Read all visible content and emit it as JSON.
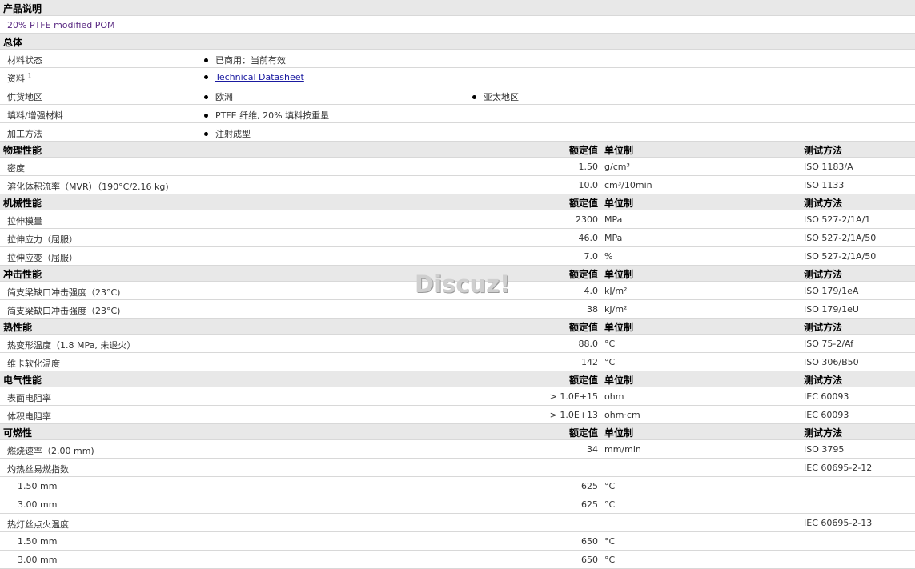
{
  "product": {
    "section_title": "产品说明",
    "description": "20% PTFE modified POM"
  },
  "general": {
    "section_title": "总体",
    "rows": [
      {
        "label": "材料状态",
        "values": [
          "已商用：当前有效"
        ]
      },
      {
        "label": "资料",
        "sup": "1",
        "link": "Technical Datasheet"
      },
      {
        "label": "供货地区",
        "values": [
          "欧洲",
          "亚太地区"
        ]
      },
      {
        "label": "填料/增强材料",
        "values": [
          "PTFE 纤维, 20% 填料按重量"
        ]
      },
      {
        "label": "加工方法",
        "values": [
          "注射成型"
        ]
      }
    ]
  },
  "col_headers": {
    "value": "额定值",
    "unit": "单位制",
    "method": "测试方法"
  },
  "sections": [
    {
      "title": "物理性能",
      "rows": [
        {
          "label": "密度",
          "value": "1.50",
          "unit": "g/cm³",
          "method": "ISO 1183/A"
        },
        {
          "label": "溶化体积流率（MVR）（190°C/2.16 kg)",
          "value": "10.0",
          "unit": "cm³/10min",
          "method": "ISO 1133"
        }
      ]
    },
    {
      "title": "机械性能",
      "rows": [
        {
          "label": "拉伸模量",
          "value": "2300",
          "unit": "MPa",
          "method": "ISO 527-2/1A/1"
        },
        {
          "label": "拉伸应力（屈服）",
          "value": "46.0",
          "unit": "MPa",
          "method": "ISO 527-2/1A/50"
        },
        {
          "label": "拉伸应变（屈服）",
          "value": "7.0",
          "unit": "%",
          "method": "ISO 527-2/1A/50"
        }
      ]
    },
    {
      "title": "冲击性能",
      "rows": [
        {
          "label": "简支梁缺口冲击强度（23°C)",
          "value": "4.0",
          "unit": "kJ/m²",
          "method": "ISO 179/1eA"
        },
        {
          "label": "简支梁缺口冲击强度（23°C)",
          "value": "38",
          "unit": "kJ/m²",
          "method": "ISO 179/1eU"
        }
      ]
    },
    {
      "title": "热性能",
      "rows": [
        {
          "label": "热变形温度（1.8 MPa, 未退火）",
          "value": "88.0",
          "unit": "°C",
          "method": "ISO 75-2/Af"
        },
        {
          "label": "维卡软化温度",
          "value": "142",
          "unit": "°C",
          "method": "ISO 306/B50"
        }
      ]
    },
    {
      "title": "电气性能",
      "rows": [
        {
          "label": "表面电阻率",
          "value": "> 1.0E+15",
          "unit": "ohm",
          "method": "IEC 60093"
        },
        {
          "label": "体积电阻率",
          "value": "> 1.0E+13",
          "unit": "ohm·cm",
          "method": "IEC 60093"
        }
      ]
    },
    {
      "title": "可燃性",
      "rows": [
        {
          "label": "燃烧速率（2.00 mm)",
          "value": "34",
          "unit": "mm/min",
          "method": "ISO 3795"
        },
        {
          "label": "灼热丝易燃指数",
          "value": "",
          "unit": "",
          "method": "IEC 60695-2-12"
        },
        {
          "label": "1.50 mm",
          "sub": true,
          "value": "625",
          "unit": "°C",
          "method": ""
        },
        {
          "label": "3.00 mm",
          "sub": true,
          "value": "625",
          "unit": "°C",
          "method": ""
        },
        {
          "label": "热灯丝点火温度",
          "value": "",
          "unit": "",
          "method": "IEC 60695-2-13"
        },
        {
          "label": "1.50 mm",
          "sub": true,
          "value": "650",
          "unit": "°C",
          "method": ""
        },
        {
          "label": "3.00 mm",
          "sub": true,
          "value": "650",
          "unit": "°C",
          "method": ""
        }
      ]
    }
  ],
  "watermark": "Discuz!"
}
